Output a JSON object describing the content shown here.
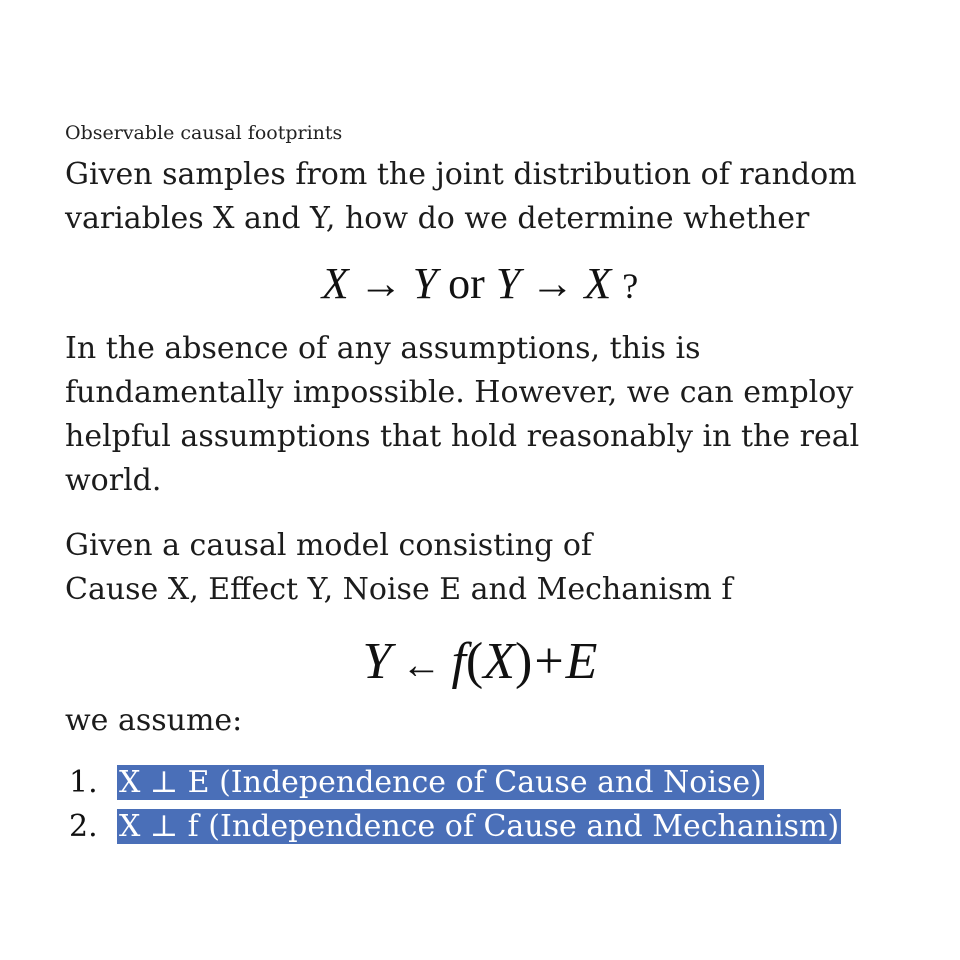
{
  "subtitle": "Observable causal footprints",
  "paragraph_1": "Given samples from the joint distribution of random variables X and Y, how do we determine whether",
  "equation_1": {
    "x1": "X",
    "arrow1": "→",
    "y1": "Y",
    "or": "or",
    "y2": "Y",
    "arrow2": "→",
    "x2": "X",
    "q": "?"
  },
  "paragraph_2": "In the absence of any assumptions, this is fundamentally impossible. However, we can employ helpful assumptions that hold reasonably in the real world.",
  "paragraph_3_line1": "Given a causal model consisting of",
  "paragraph_3_line2": "Cause X, Effect Y, Noise E and Mechanism f",
  "equation_2": {
    "y": "Y",
    "arrow": "←",
    "f": "f",
    "lp": "(",
    "x": "X",
    "rp": ")",
    "plus": "+",
    "e": "E"
  },
  "paragraph_4": "we assume:",
  "assumptions": [
    {
      "number": "1.",
      "text": "X ⊥ E (Independence of Cause and Noise)"
    },
    {
      "number": "2.",
      "text": "X ⊥ f  (Independence of Cause and Mechanism)"
    }
  ],
  "colors": {
    "highlight": "#4a6fb8",
    "highlight_text": "#ffffff"
  }
}
